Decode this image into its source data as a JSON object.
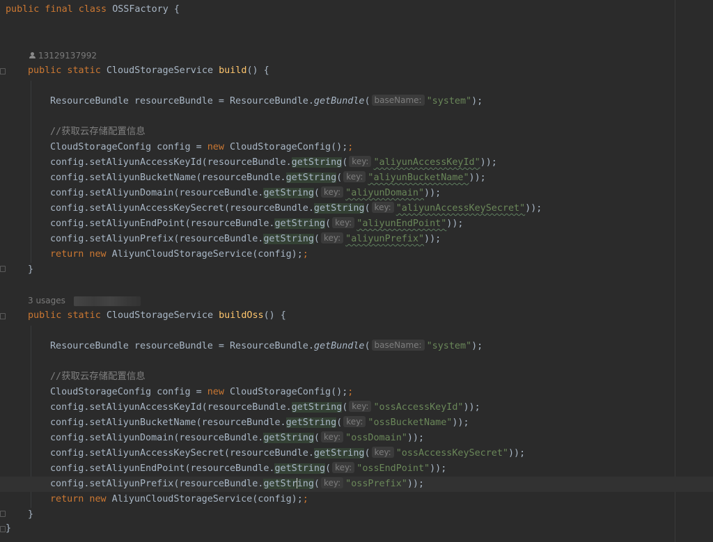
{
  "editor": {
    "author_hint": "13129137992",
    "usages_hint": "3 usages",
    "class_header": {
      "modifiers": "public final class ",
      "name": "OSSFactory",
      "brace": " {"
    },
    "methods": [
      {
        "modifiers": "public static ",
        "return_type": "CloudStorageService ",
        "name": "build",
        "sig_tail": "() {",
        "bundle_decl": "ResourceBundle resourceBundle = ResourceBundle.",
        "bundle_call": "getBundle",
        "bundle_hint": "baseName:",
        "bundle_arg": "\"system\"",
        "comment": "//获取云存储配置信息",
        "config_type": "CloudStorageConfig config = ",
        "config_new": "new",
        "config_ctor": " CloudStorageConfig();",
        "setters": [
          {
            "call": "config.setAliyunAccessKeyId(resourceBundle.",
            "key": "\"aliyunAccessKeyId\""
          },
          {
            "call": "config.setAliyunBucketName(resourceBundle.",
            "key": "\"aliyunBucketName\""
          },
          {
            "call": "config.setAliyunDomain(resourceBundle.",
            "key": "\"aliyunDomain\""
          },
          {
            "call": "config.setAliyunAccessKeySecret(resourceBundle.",
            "key": "\"aliyunAccessKeySecret\""
          },
          {
            "call": "config.setAliyunEndPoint(resourceBundle.",
            "key": "\"aliyunEndPoint\""
          },
          {
            "call": "config.setAliyunPrefix(resourceBundle.",
            "key": "\"aliyunPrefix\""
          }
        ],
        "return_kw": "return new",
        "return_expr": " AliyunCloudStorageService(config);"
      },
      {
        "modifiers": "public static ",
        "return_type": "CloudStorageService ",
        "name": "buildOss",
        "sig_tail": "() {",
        "bundle_decl": "ResourceBundle resourceBundle = ResourceBundle.",
        "bundle_call": "getBundle",
        "bundle_hint": "baseName:",
        "bundle_arg": "\"system\"",
        "comment": "//获取云存储配置信息",
        "config_type": "CloudStorageConfig config = ",
        "config_new": "new",
        "config_ctor": " CloudStorageConfig();",
        "setters": [
          {
            "call": "config.setAliyunAccessKeyId(resourceBundle.",
            "key": "\"ossAccessKeyId\""
          },
          {
            "call": "config.setAliyunBucketName(resourceBundle.",
            "key": "\"ossBucketName\""
          },
          {
            "call": "config.setAliyunDomain(resourceBundle.",
            "key": "\"ossDomain\""
          },
          {
            "call": "config.setAliyunAccessKeySecret(resourceBundle.",
            "key": "\"ossAccessKeySecret\""
          },
          {
            "call": "config.setAliyunEndPoint(resourceBundle.",
            "key": "\"ossEndPoint\""
          },
          {
            "call": "config.setAliyunPrefix(resourceBundle.",
            "key": "\"ossPrefix\""
          }
        ],
        "return_kw": "return new",
        "return_expr": " AliyunCloudStorageService(config);"
      }
    ],
    "getstring_call": "getString",
    "getstring_call_a": "getStr",
    "getstring_call_b": "ing",
    "key_hint": "key:",
    "call_close": "));",
    "paren_open": "(",
    "close_paren": ");",
    "semicolon": ";",
    "block_close": "}",
    "colors": {
      "background": "#2b2b2b",
      "keyword": "#cc7832",
      "method_decl": "#ffc66d",
      "string": "#6a8759",
      "comment": "#808080",
      "plain": "#a9b7c6",
      "usage_highlight": "#344134"
    }
  }
}
